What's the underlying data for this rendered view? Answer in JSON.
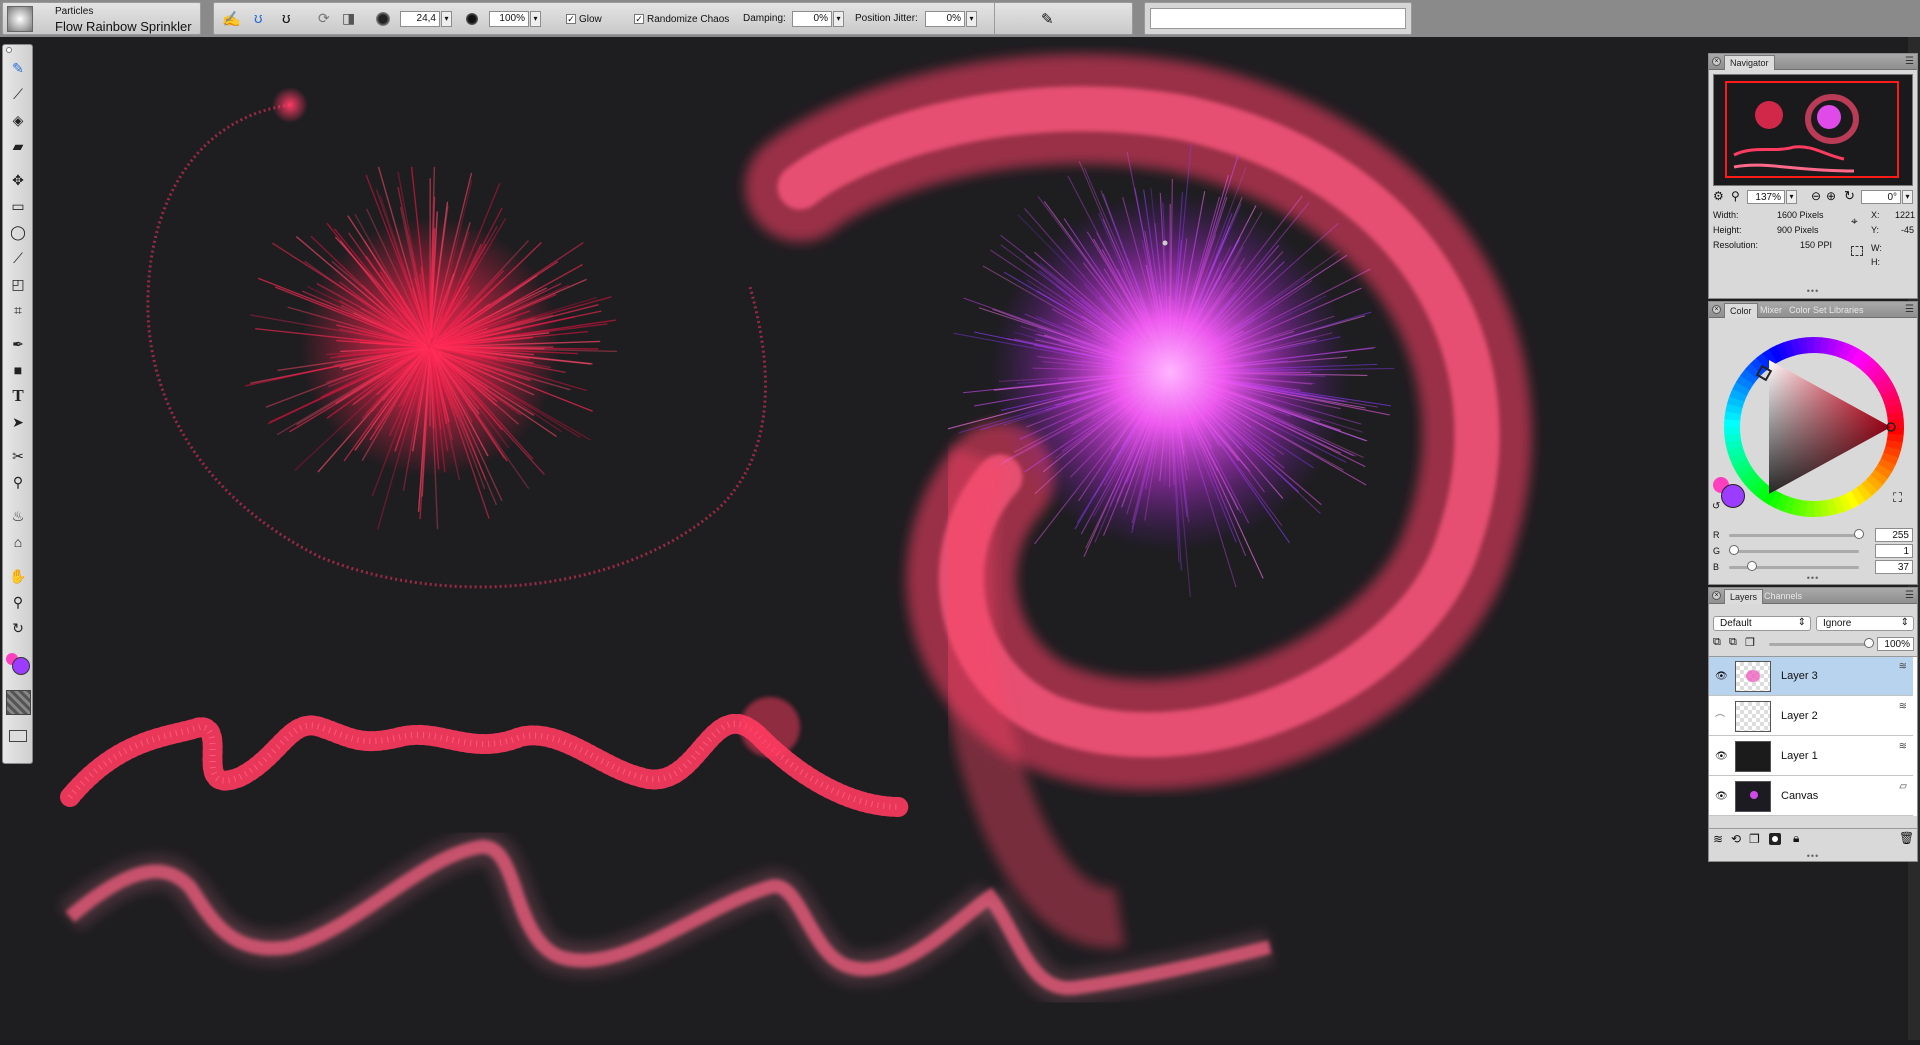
{
  "app": {
    "brush_category": "Particles",
    "brush_variant": "Flow Rainbow Sprinkler"
  },
  "propbar": {
    "size_value": "24,4",
    "opacity_value": "100%",
    "glow_label": "Glow",
    "glow_checked": "✓",
    "randomize_label": "Randomize Chaos",
    "randomize_checked": "✓",
    "damping_label": "Damping:",
    "damping_value": "0%",
    "jitter_label": "Position Jitter:",
    "jitter_value": "0%",
    "search_placeholder": ""
  },
  "toolbox": {
    "tools": [
      "brush-tool",
      "dropper-tool",
      "paint-bucket-tool",
      "eraser-tool",
      "layer-adjuster-tool",
      "rectangular-selection-tool",
      "lasso-tool",
      "magic-wand-tool",
      "transform-tool",
      "crop-tool",
      "pen-tool",
      "rectangle-shape-tool",
      "text-tool",
      "shape-selection-tool",
      "cloner-tool",
      "rubber-stamp-tool",
      "dodge-tool",
      "burn-tool",
      "grabber-tool",
      "magnifier-tool",
      "rotate-page-tool"
    ],
    "main_color": "#9b3cff",
    "additional_color": "#ff3fc0"
  },
  "navigator": {
    "tab": "Navigator",
    "zoom": "137%",
    "rotation": "0°",
    "width_label": "Width:",
    "width_value": "1600 Pixels",
    "height_label": "Height:",
    "height_value": "900 Pixels",
    "res_label": "Resolution:",
    "res_value": "150 PPI",
    "x_label": "X:",
    "x_value": "1221",
    "y_label": "Y:",
    "y_value": "-45",
    "w_label": "W:",
    "h_label": "H:"
  },
  "color": {
    "tabs": [
      "Color",
      "Mixer",
      "Color Set Libraries"
    ],
    "r_label": "R",
    "g_label": "G",
    "b_label": "B",
    "r_value": "255",
    "g_value": "1",
    "b_value": "37",
    "r": 255,
    "g": 1,
    "b": 37
  },
  "layers": {
    "tabs": [
      "Layers",
      "Channels"
    ],
    "composite_method": "Default",
    "composite_depth": "Ignore",
    "opacity": "100%",
    "items": [
      {
        "name": "Layer 3",
        "selected": true,
        "visible": true
      },
      {
        "name": "Layer 2",
        "selected": false,
        "visible": false
      },
      {
        "name": "Layer 1",
        "selected": false,
        "visible": true
      },
      {
        "name": "Canvas",
        "selected": false,
        "visible": true
      }
    ]
  }
}
